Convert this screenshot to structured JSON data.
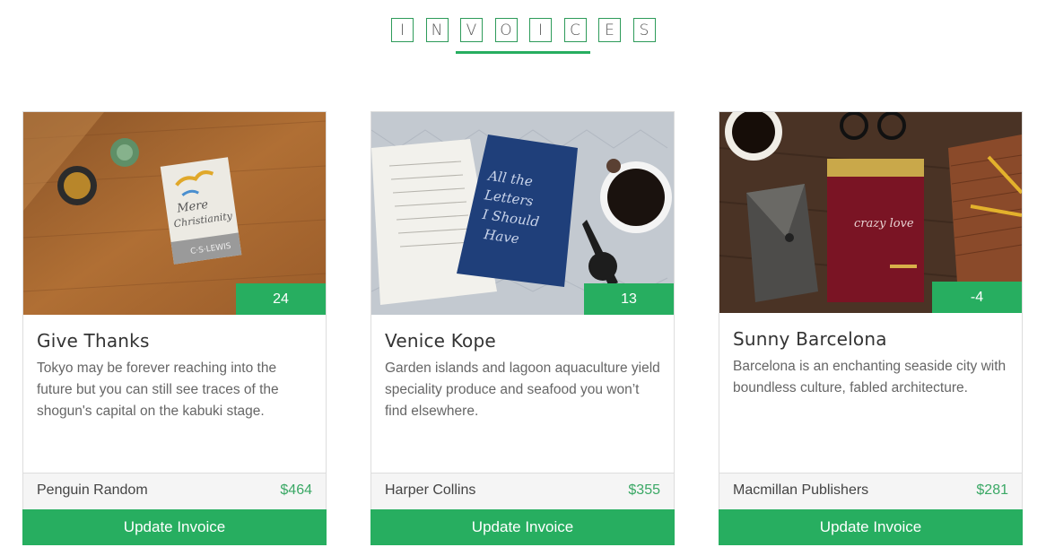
{
  "heading": {
    "letters": [
      "I",
      "N",
      "V",
      "O",
      "I",
      "C",
      "E",
      "S"
    ]
  },
  "cards": [
    {
      "image": "book-mere-christianity-photo",
      "badge": "24",
      "title": "Give Thanks",
      "description": "Tokyo may be forever reaching into the future but you can still see traces of the shogun's capital on the kabuki stage.",
      "publisher": "Penguin Random",
      "price": "$464",
      "button_label": "Update Invoice"
    },
    {
      "image": "book-all-the-letters-photo",
      "badge": "13",
      "title": "Venice Kope",
      "description": "Garden islands and lagoon aquaculture yield speciality produce and seafood you won’t find elsewhere.",
      "publisher": "Harper Collins",
      "price": "$355",
      "button_label": "Update Invoice"
    },
    {
      "image": "book-crazy-love-photo",
      "badge": "-4",
      "title": "Sunny Barcelona",
      "description": "Barcelona is an enchanting seaside city with boundless culture, fabled architecture.",
      "publisher": "Macmillan Publishers",
      "price": "$281",
      "button_label": "Update Invoice"
    }
  ],
  "colors": {
    "accent": "#27ae60",
    "price": "#3aa865",
    "footer_bg": "#f5f5f5"
  }
}
